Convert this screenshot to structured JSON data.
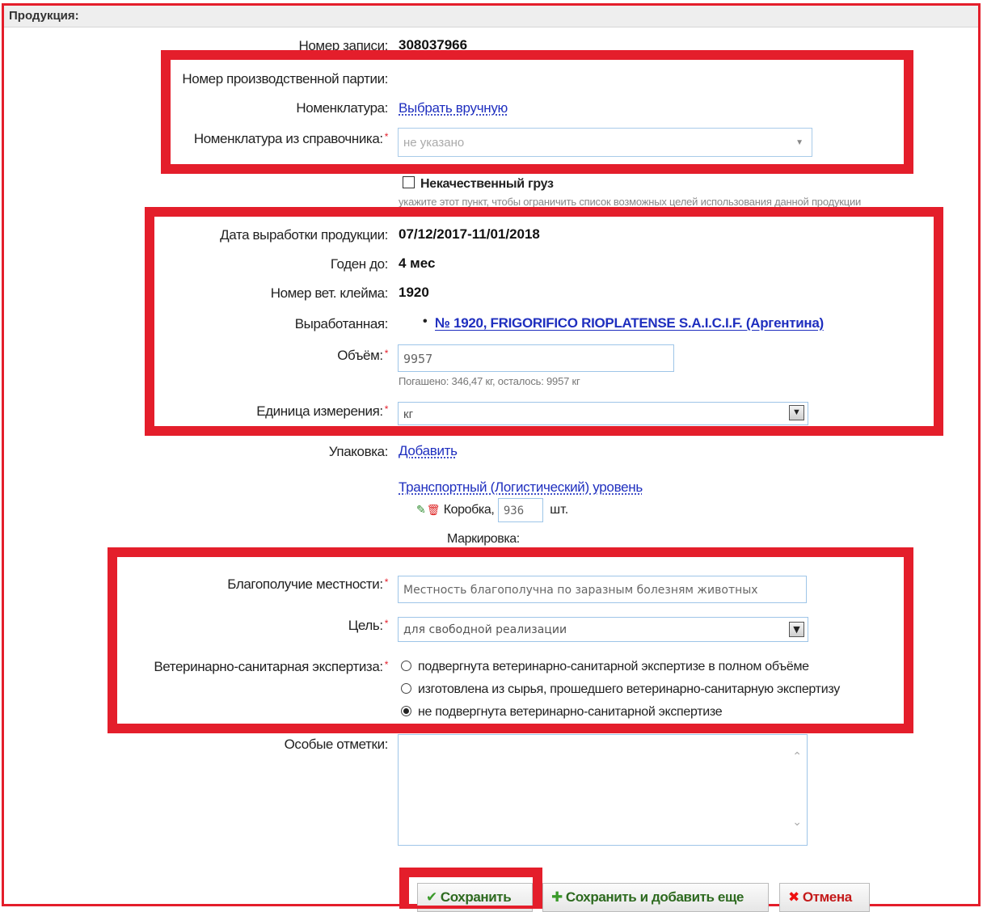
{
  "section": {
    "title": "Продукция:"
  },
  "fields": {
    "record_number": {
      "label": "Номер записи:",
      "value": "308037966"
    },
    "batch_number": {
      "label": "Номер производственной партии:"
    },
    "nomenclature": {
      "label": "Номенклатура:",
      "link": "Выбрать вручную"
    },
    "nomenclature_ref": {
      "label": "Номенклатура из справочника:",
      "placeholder": "не указано"
    },
    "bad_cargo": {
      "label": "Некачественный груз",
      "hint": "укажите этот пункт, чтобы ограничить список возможных целей использования данной продукции"
    },
    "production_date": {
      "label": "Дата выработки продукции:",
      "value": "07/12/2017-11/01/2018"
    },
    "expiry": {
      "label": "Годен до:",
      "value": "4 мес"
    },
    "vet_stamp": {
      "label": "Номер вет. клейма:",
      "value": "1920"
    },
    "produced": {
      "label": "Выработанная:",
      "bullet": "•",
      "link": "№ 1920, FRIGORIFICO RIOPLATENSE S.A.I.C.I.F. (Аргентина)"
    },
    "volume": {
      "label": "Объём:",
      "value": "9957",
      "hint": "Погашено: 346,47 кг, осталось: 9957 кг"
    },
    "unit": {
      "label": "Единица измерения:",
      "value": "кг"
    },
    "packaging": {
      "label": "Упаковка:",
      "add_link": "Добавить",
      "level_link": "Транспортный (Логистический) уровень",
      "item": "Коробка,",
      "count": "936",
      "count_unit": "шт.",
      "marking": "Маркировка:"
    },
    "locality": {
      "label": "Благополучие местности:",
      "value": "Местность благополучна по заразным болезням животных"
    },
    "purpose": {
      "label": "Цель:",
      "value": "для свободной реализации"
    },
    "vet_exam": {
      "label": "Ветеринарно-санитарная экспертиза:",
      "options": [
        {
          "label": "подвергнута ветеринарно-санитарной экспертизе в полном объёме",
          "checked": false
        },
        {
          "label": "изготовлена из сырья, прошедшего ветеринарно-санитарную экспертизу",
          "checked": false
        },
        {
          "label": "не подвергнута ветеринарно-санитарной экспертизе",
          "checked": true
        }
      ]
    },
    "notes": {
      "label": "Особые отметки:"
    }
  },
  "required_mark": "*",
  "buttons": {
    "save": "Сохранить",
    "save_add": "Сохранить и добавить еще",
    "cancel": "Отмена"
  },
  "colors": {
    "highlight": "#e41e2b",
    "link": "#1f2fbf",
    "input_border": "#9ec5e8"
  }
}
